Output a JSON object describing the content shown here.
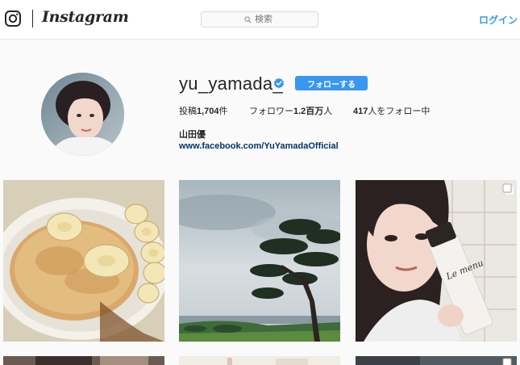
{
  "nav": {
    "wordmark": "Instagram",
    "search_placeholder": "検索",
    "login_label": "ログイン"
  },
  "profile": {
    "username": "yu_yamada_",
    "verified": true,
    "follow_label": "フォローする",
    "posts_label": "投稿",
    "posts_count": "1,704",
    "posts_suffix": "件",
    "followers_label": "フォロワー",
    "followers_count": "1.2百万",
    "followers_suffix": "人",
    "following_count": "417",
    "following_suffix": "人をフォロー中",
    "full_name": "山田優",
    "website": "www.facebook.com/YuYamadaOfficial"
  },
  "posts": [
    {
      "subject": "banana pancakes on a plate",
      "multi": false
    },
    {
      "subject": "pine tree on cloudy seaside hill",
      "multi": false
    },
    {
      "subject": "selfie holding skincare bottle",
      "multi": true,
      "bottle_text": "Le menu"
    },
    {
      "subject": "partial post",
      "multi": false
    },
    {
      "subject": "partial post",
      "multi": false
    },
    {
      "subject": "partial post",
      "multi": true
    }
  ],
  "colors": {
    "accent": "#3897f0",
    "link": "#003569",
    "background": "#fafafa"
  }
}
